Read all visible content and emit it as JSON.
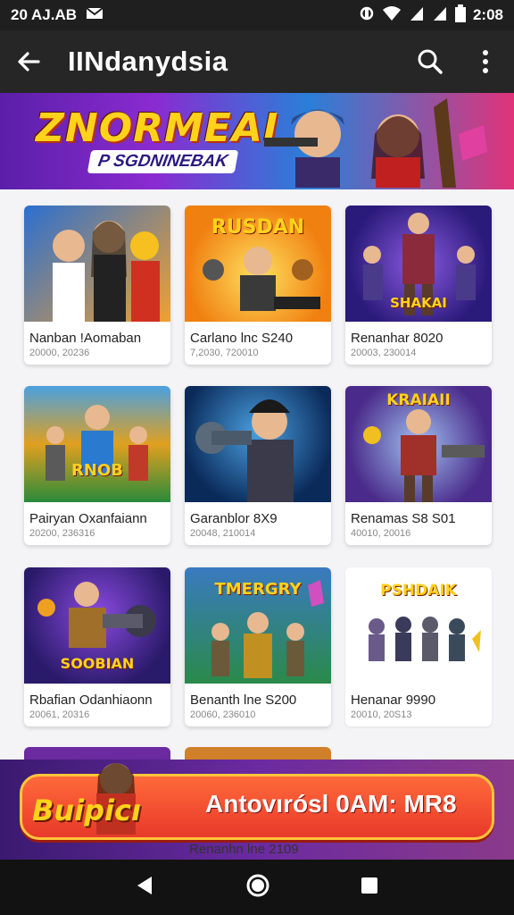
{
  "status_bar": {
    "time_left": "20 AJ.AB",
    "time_right": "2:08",
    "battery": "▮"
  },
  "app_bar": {
    "title": "IINdanydsia"
  },
  "banner": {
    "title": "ZNORMEAI",
    "subtitle": "P SGDNINEBAK"
  },
  "cards": [
    {
      "name": "Nanban !Aomaban",
      "meta": "20000, 20236",
      "thumb_label": "",
      "colors": [
        "#2b6fd0",
        "#f0a030"
      ]
    },
    {
      "name": "Carlano lnc S240",
      "meta": "7,2030, 720010",
      "thumb_label": "RUSDAN",
      "colors": [
        "#f0a020",
        "#e05a10"
      ]
    },
    {
      "name": "Renanhar 8020",
      "meta": "20003, 230014",
      "thumb_label": "SHAKAI",
      "colors": [
        "#3a1f9a",
        "#d03a8a"
      ]
    },
    {
      "name": "Pairyan Oxanfaiann",
      "meta": "20200, 236316",
      "thumb_label": "RNOB",
      "colors": [
        "#1e8a3a",
        "#e0a020"
      ]
    },
    {
      "name": "Garanblor 8X9",
      "meta": "20048, 210014",
      "thumb_label": "",
      "colors": [
        "#1a3a6a",
        "#4aa0e0"
      ]
    },
    {
      "name": "Renamas S8 S01",
      "meta": "40010, 20016",
      "thumb_label": "KRAIAII",
      "colors": [
        "#4a2a8a",
        "#d05a3a"
      ]
    },
    {
      "name": "Rbafian Odanhiaonn",
      "meta": "20061, 20316",
      "thumb_label": "SOOBIAN",
      "colors": [
        "#2a1a6a",
        "#d0402a"
      ]
    },
    {
      "name": "Benanth lne S200",
      "meta": "20060, 236010",
      "thumb_label": "TMERGRY",
      "colors": [
        "#1a6a4a",
        "#e0c030"
      ]
    },
    {
      "name": "Henanar 9990",
      "meta": "20010, 20S13",
      "thumb_label": "PSHDAIK",
      "colors": [
        "#ffffff",
        "#ffffff"
      ]
    }
  ],
  "peek_card": {
    "name": "Renanhn lne 2109"
  },
  "promo": {
    "badge": "Buipicı",
    "text": "Antovırósl 0AM: MR8"
  },
  "nav": {
    "back": "back-icon",
    "home": "home-icon",
    "recents": "recents-icon"
  }
}
